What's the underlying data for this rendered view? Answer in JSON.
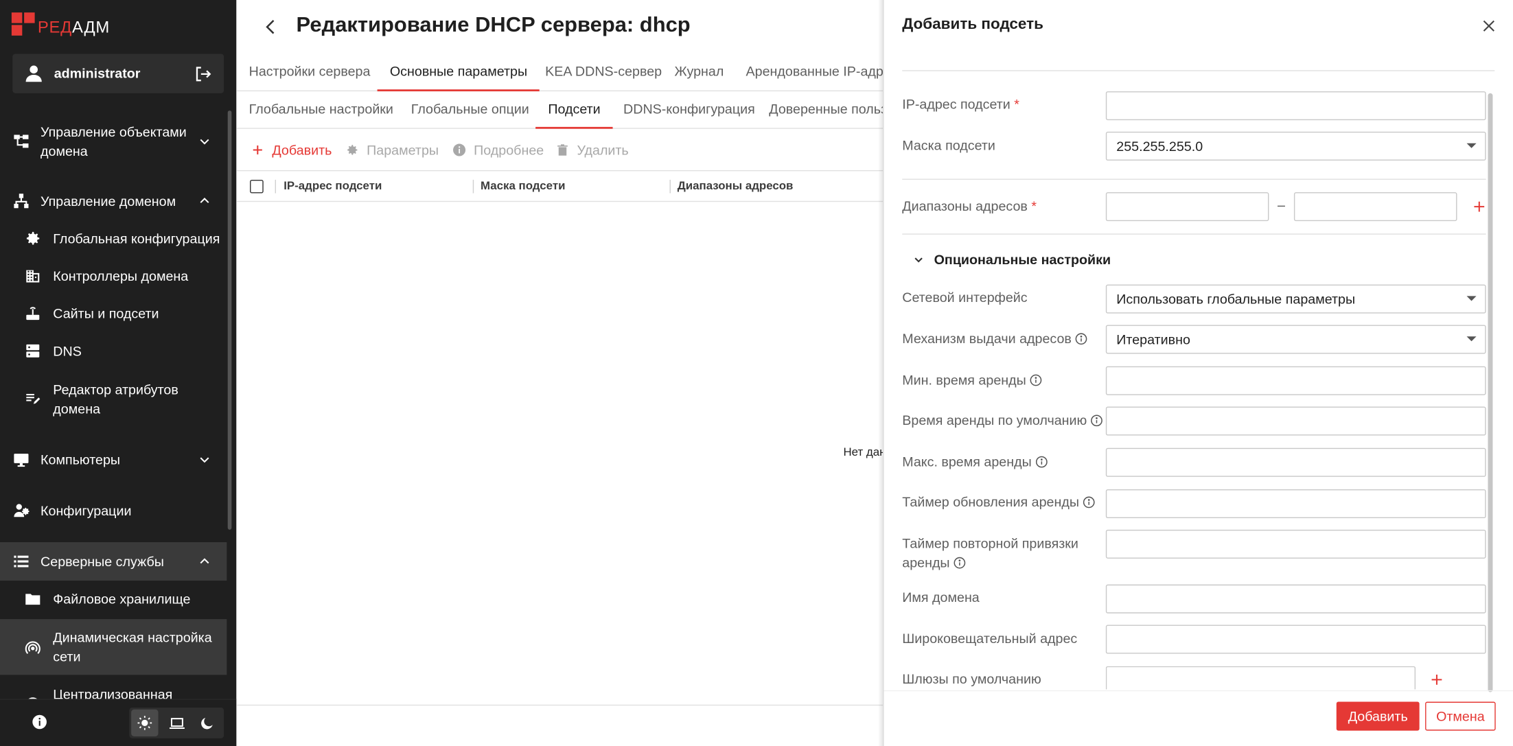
{
  "sidebar": {
    "logo": {
      "part_red": "РЕД",
      "part_white": "АДМ",
      "brand_color": "#e53935"
    },
    "user": {
      "name": "administrator",
      "icon": "user-icon",
      "logout_icon": "logout-icon"
    },
    "items": [
      {
        "label_line1": "Управление объектами",
        "label_line2": "домена",
        "icon": "hierarchy-icon",
        "chevron": "down"
      },
      {
        "label": "Управление доменом",
        "icon": "domain-tree-icon",
        "chevron": "up"
      },
      {
        "label": "Глобальная конфигурация",
        "icon": "gear-icon",
        "sub": true
      },
      {
        "label": "Контроллеры домена",
        "icon": "building-icon",
        "sub": true
      },
      {
        "label": "Сайты и подсети",
        "icon": "router-icon",
        "sub": true
      },
      {
        "label": "DNS",
        "icon": "server-icon",
        "sub": true
      },
      {
        "label_line1": "Редактор атрибутов",
        "label_line2": "домена",
        "icon": "edit-list-icon",
        "sub": true
      },
      {
        "label": "Компьютеры",
        "icon": "monitor-icon",
        "chevron": "down"
      },
      {
        "label": "Конфигурации",
        "icon": "config-icon"
      },
      {
        "label": "Серверные службы",
        "icon": "list-icon",
        "chevron": "up"
      },
      {
        "label": "Файловое хранилище",
        "icon": "folder-icon",
        "sub": true
      },
      {
        "label_line1": "Динамическая настройка",
        "label_line2": "сети",
        "icon": "network-icon",
        "sub": true,
        "selected": true
      },
      {
        "label": "Централизованная",
        "icon": "circle-icon",
        "sub": true
      }
    ],
    "bottom": {
      "info_icon": "info-icon",
      "themes": [
        "light-theme-icon",
        "system-theme-icon",
        "dark-theme-icon"
      ],
      "active_theme": "light"
    }
  },
  "main": {
    "title": "Редактирование DHCP сервера: dhcp",
    "tabs1": [
      "Настройки сервера",
      "Основные параметры",
      "KEA DDNS-сервер",
      "Журнал",
      "Арендованные IP-адрес"
    ],
    "tabs1_active": 1,
    "tabs2": [
      "Глобальные настройки",
      "Глобальные опции",
      "Подсети",
      "DDNS-конфигурация",
      "Доверенные польз"
    ],
    "tabs2_active": 2,
    "toolbar": {
      "add": "Добавить",
      "params": "Параметры",
      "details": "Подробнее",
      "delete": "Удалить"
    },
    "table": {
      "columns": [
        "IP-адрес подсети",
        "Маска подсети",
        "Диапазоны адресов"
      ],
      "rows": [],
      "empty_text": "Нет дан"
    }
  },
  "drawer": {
    "title": "Добавить подсеть",
    "fields": {
      "subnet_ip": {
        "label": "IP-адрес подсети",
        "required": "*",
        "value": ""
      },
      "subnet_mask": {
        "label": "Маска подсети",
        "value": "255.255.255.0"
      },
      "ranges": {
        "label": "Диапазоны адресов",
        "required": "*",
        "from": "",
        "to": "",
        "dash": "–"
      },
      "optional_header": "Опциональные настройки",
      "net_iface": {
        "label": "Сетевой интерфейс",
        "value": "Использовать глобальные параметры"
      },
      "alloc": {
        "label": "Механизм выдачи адресов",
        "value": "Итеративно"
      },
      "min_lease": {
        "label": "Мин. время аренды",
        "value": ""
      },
      "default_lease": {
        "label": "Время аренды по умолчанию",
        "value": ""
      },
      "max_lease": {
        "label": "Макс. время аренды",
        "value": ""
      },
      "renew_timer": {
        "label": "Таймер обновления аренды",
        "value": ""
      },
      "rebind_timer": {
        "label_line1": "Таймер повторной привязки",
        "label_line2": "аренды",
        "value": ""
      },
      "domain_name": {
        "label": "Имя домена",
        "value": ""
      },
      "broadcast": {
        "label": "Широковещательный адрес",
        "value": ""
      },
      "gateways": {
        "label": "Шлюзы по умолчанию",
        "value": ""
      }
    },
    "buttons": {
      "submit": "Добавить",
      "cancel": "Отмена"
    }
  },
  "colors": {
    "accent": "#e53935",
    "sidebar_bg": "#1f1f1f",
    "sidebar_selected": "#3a3a3a"
  }
}
